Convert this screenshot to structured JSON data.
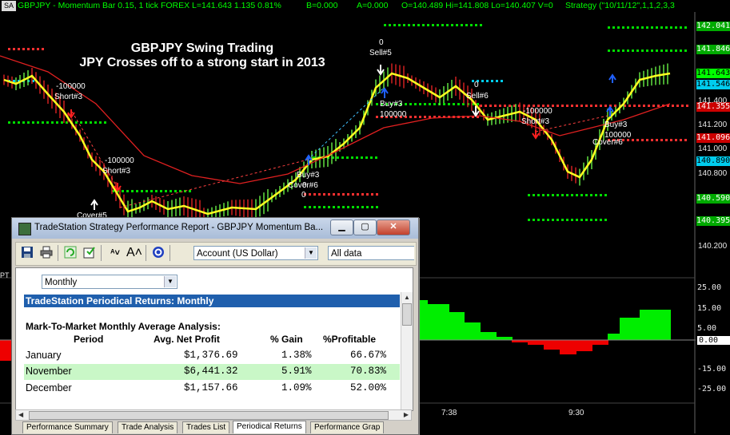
{
  "header": {
    "sa_label": "SA",
    "symbol_line": "GBPJPY - Momentum Bar 0.15, 1 tick  FOREX  L=141.643  1.135  0.81%",
    "b_value": "B=0.000",
    "a_value": "A=0.000",
    "ohlc": "O=140.489  Hi=141.808  Lo=140.407  V=0",
    "strategy": "Strategy (\"10/11/12\",1,1,2,3,3"
  },
  "chart_title": {
    "line1": "GBPJPY Swing Trading",
    "line2": "JPY Crosses off to a strong start in 2013"
  },
  "price_labels": [
    {
      "text": "142.041",
      "bg": "#00aa00",
      "fg": "#ffffff"
    },
    {
      "text": "141.846",
      "bg": "#00aa00",
      "fg": "#ffffff"
    },
    {
      "text": "141.643",
      "bg": "#00ff00",
      "fg": "#000000"
    },
    {
      "text": "141.546",
      "bg": "#00ccee",
      "fg": "#000000"
    },
    {
      "text": "141.355",
      "bg": "#cc0000",
      "fg": "#ffffff"
    },
    {
      "text": "141.096",
      "bg": "#cc0000",
      "fg": "#ffffff"
    },
    {
      "text": "140.890",
      "bg": "#00ccee",
      "fg": "#000000"
    },
    {
      "text": "140.590",
      "bg": "#00aa00",
      "fg": "#ffffff"
    },
    {
      "text": "140.395",
      "bg": "#00aa00",
      "fg": "#ffffff"
    }
  ],
  "price_axis_ticks": [
    "141.400",
    "141.200",
    "141.000",
    "140.800",
    "140.200"
  ],
  "osc_axis_ticks": [
    "25.00",
    "15.00",
    "5.00",
    "0.00",
    "-15.00",
    "-25.00"
  ],
  "time_labels": [
    "7:38",
    "9:30"
  ],
  "pt_label": "PT",
  "trade_labels": {
    "t1": "-100000",
    "t2": "Short#3",
    "t3": "-100000",
    "t4": "Short#3",
    "t5": "Cover#5",
    "t6": "Buy#3",
    "t7": "Cover#6",
    "t8": "0",
    "t9": "0",
    "t10": "Sell#5",
    "t11": "Buy#3",
    "t12": "100000",
    "t13": "0",
    "t14": "Sell#6",
    "t15": "-100000",
    "t16": "Short#3",
    "t17": "Buy#3",
    "t18": "100000",
    "t19": "Cover#6",
    "t20": "0"
  },
  "window": {
    "title": "TradeStation Strategy Performance Report - GBPJPY Momentum Ba...",
    "buttons": {
      "minimize": "▁",
      "maximize": "▢",
      "close": "✕"
    },
    "toolbar": {
      "currency_select": "Account (US Dollar)",
      "data_select": "All data"
    },
    "period_select": "Monthly",
    "section_header": "TradeStation Periodical Returns: Monthly",
    "analysis_title": "Mark-To-Market Monthly Average Analysis:",
    "columns": [
      "Period",
      "Avg. Net Profit",
      "% Gain",
      "%Profitable"
    ],
    "rows": [
      {
        "period": "January",
        "profit": "$1,376.69",
        "gain": "1.38%",
        "profitable": "66.67%"
      },
      {
        "period": "November",
        "profit": "$6,441.32",
        "gain": "5.91%",
        "profitable": "70.83%"
      },
      {
        "period": "December",
        "profit": "$1,157.66",
        "gain": "1.09%",
        "profitable": "52.00%"
      }
    ],
    "tabs": [
      "Performance Summary",
      "Trade Analysis",
      "Trades List",
      "Periodical Returns",
      "Performance Grap"
    ]
  }
}
